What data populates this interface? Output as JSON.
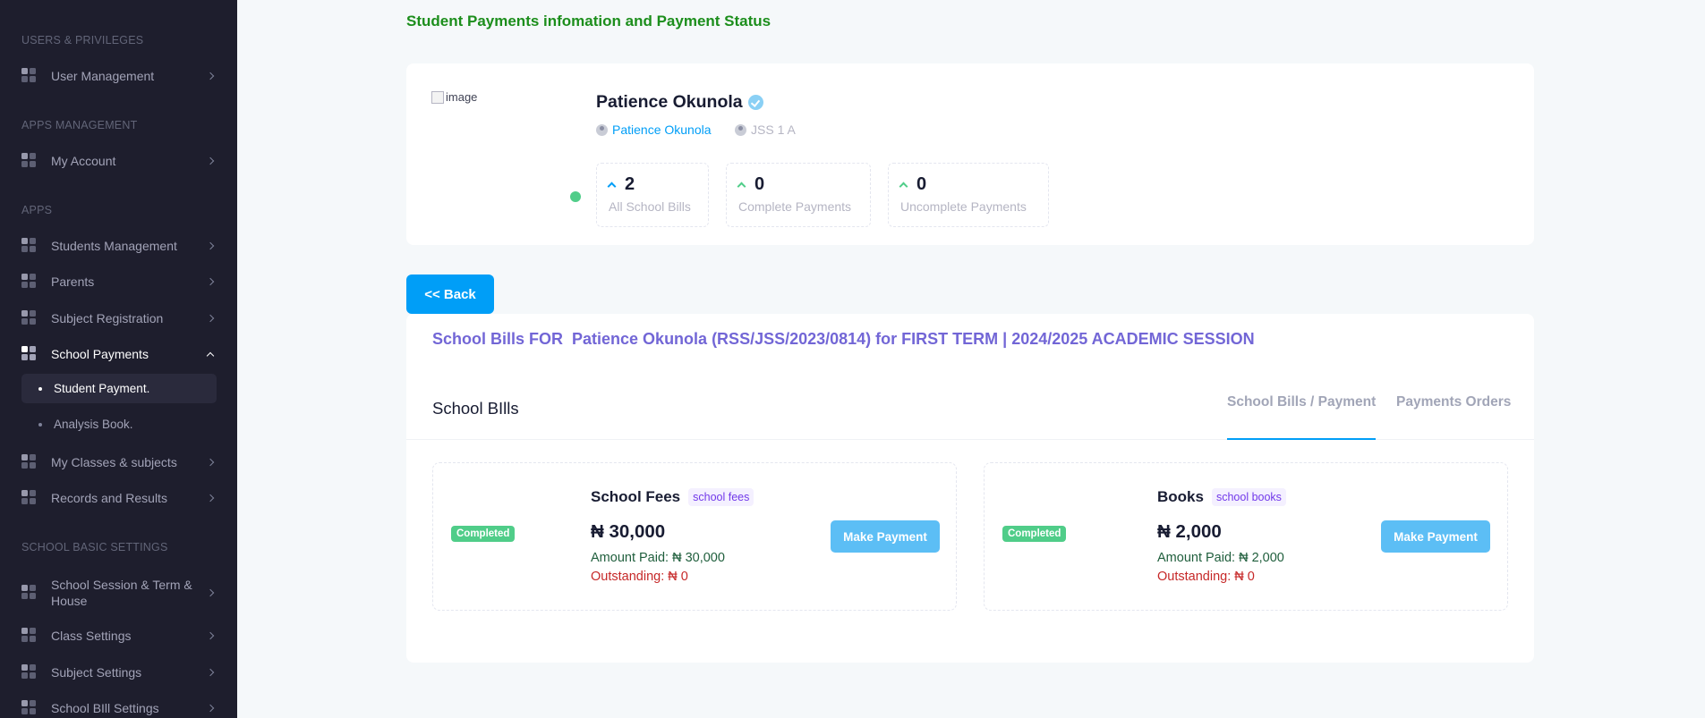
{
  "sidebar": {
    "sections": {
      "users": "USERS & PRIVILEGES",
      "apps_mgmt": "APPS MANAGEMENT",
      "apps": "APPS",
      "basic": "SCHOOL BASIC SETTINGS"
    },
    "items": {
      "user_management": "User Management",
      "my_account": "My Account",
      "students_management": "Students Management",
      "parents": "Parents",
      "subject_registration": "Subject Registration",
      "school_payments": "School Payments",
      "student_payment": "Student Payment.",
      "analysis_book": "Analysis Book.",
      "my_classes": "My Classes & subjects",
      "records": "Records and Results",
      "session_term": "School Session & Term & House",
      "class_settings": "Class Settings",
      "subject_settings": "Subject Settings",
      "bill_settings": "School BIll Settings"
    }
  },
  "page": {
    "title": "Student Payments infomation and Payment Status"
  },
  "profile": {
    "image_alt": "image",
    "name": "Patience Okunola",
    "link_name": "Patience Okunola",
    "class_name": "JSS 1 A",
    "stats": [
      {
        "value": "2",
        "label": "All School Bills"
      },
      {
        "value": "0",
        "label": "Complete Payments"
      },
      {
        "value": "0",
        "label": "Uncomplete Payments"
      }
    ]
  },
  "back_label": "<< Back",
  "bills": {
    "title": "School Bills FOR  Patience Okunola (RSS/JSS/2023/0814) for FIRST TERM | 2024/2025 ACADEMIC SESSION",
    "heading": "School BIlls",
    "tabs": [
      "School Bills / Payment",
      "Payments Orders"
    ],
    "items": [
      {
        "status": "Completed",
        "name": "School Fees",
        "tag": "school fees",
        "amount": "₦ 30,000",
        "paid": "Amount Paid: ₦ 30,000",
        "outstanding": "Outstanding: ₦ 0",
        "button": "Make Payment"
      },
      {
        "status": "Completed",
        "name": "Books",
        "tag": "school books",
        "amount": "₦ 2,000",
        "paid": "Amount Paid: ₦ 2,000",
        "outstanding": "Outstanding: ₦ 0",
        "button": "Make Payment"
      }
    ]
  }
}
